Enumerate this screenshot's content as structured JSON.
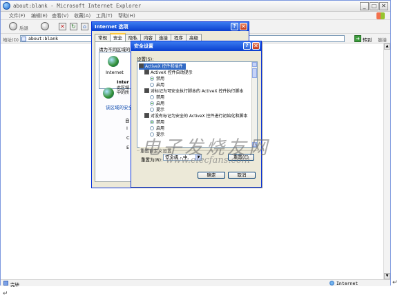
{
  "browser": {
    "title": "about:blank - Microsoft Internet Explorer",
    "menu": [
      "文件(F)",
      "编辑(E)",
      "查看(V)",
      "收藏(A)",
      "工具(T)",
      "帮助(H)"
    ],
    "back_label": "后退",
    "address_label": "地址(D)",
    "address_value": "about:blank",
    "go_label": "转到",
    "links_label": "链接",
    "status_text": "完毕",
    "status_zone": "Internet"
  },
  "internet_options": {
    "title": "Internet 选项",
    "tabs": [
      "常规",
      "安全",
      "隐私",
      "内容",
      "连接",
      "程序",
      "高级"
    ],
    "active_tab": "安全",
    "zone_prompt": "请为不同区域的",
    "zone_name": "Internet",
    "zone_info_title": "Inter",
    "zone_info_lines": [
      "此区域",
      "中的所"
    ],
    "zone_level_link": "该区域的安全",
    "fragment_chars": [
      "自",
      "I",
      "C",
      "E"
    ]
  },
  "security_settings": {
    "title": "安全设置",
    "settings_label": "设置(S):",
    "items": [
      {
        "type": "category",
        "text": "ActiveX 控件和插件",
        "selected": true
      },
      {
        "type": "item",
        "text": "ActiveX 控件自动提示"
      },
      {
        "type": "radio",
        "text": "禁用",
        "checked": true
      },
      {
        "type": "radio",
        "text": "启用",
        "checked": false
      },
      {
        "type": "item",
        "text": "对标记为可安全执行脚本的 ActiveX 控件执行脚本"
      },
      {
        "type": "radio",
        "text": "禁用",
        "checked": false
      },
      {
        "type": "radio",
        "text": "启用",
        "checked": true
      },
      {
        "type": "radio",
        "text": "提示",
        "checked": false
      },
      {
        "type": "item",
        "text": "对没有标记为安全的 ActiveX 控件进行初始化和脚本"
      },
      {
        "type": "radio",
        "text": "禁用",
        "checked": true
      },
      {
        "type": "radio",
        "text": "启用",
        "checked": false
      },
      {
        "type": "radio",
        "text": "提示",
        "checked": false
      }
    ],
    "reset_group_title": "重置自定义设置",
    "reset_to_label": "重置为(R):",
    "reset_select_value": "安全级 - 中",
    "reset_button": "重置(E)",
    "ok_button": "确定",
    "cancel_button": "取消"
  },
  "watermark": {
    "text": "电子发烧友网",
    "url": "www.elecfans.com"
  },
  "paragraph_mark": "↵"
}
